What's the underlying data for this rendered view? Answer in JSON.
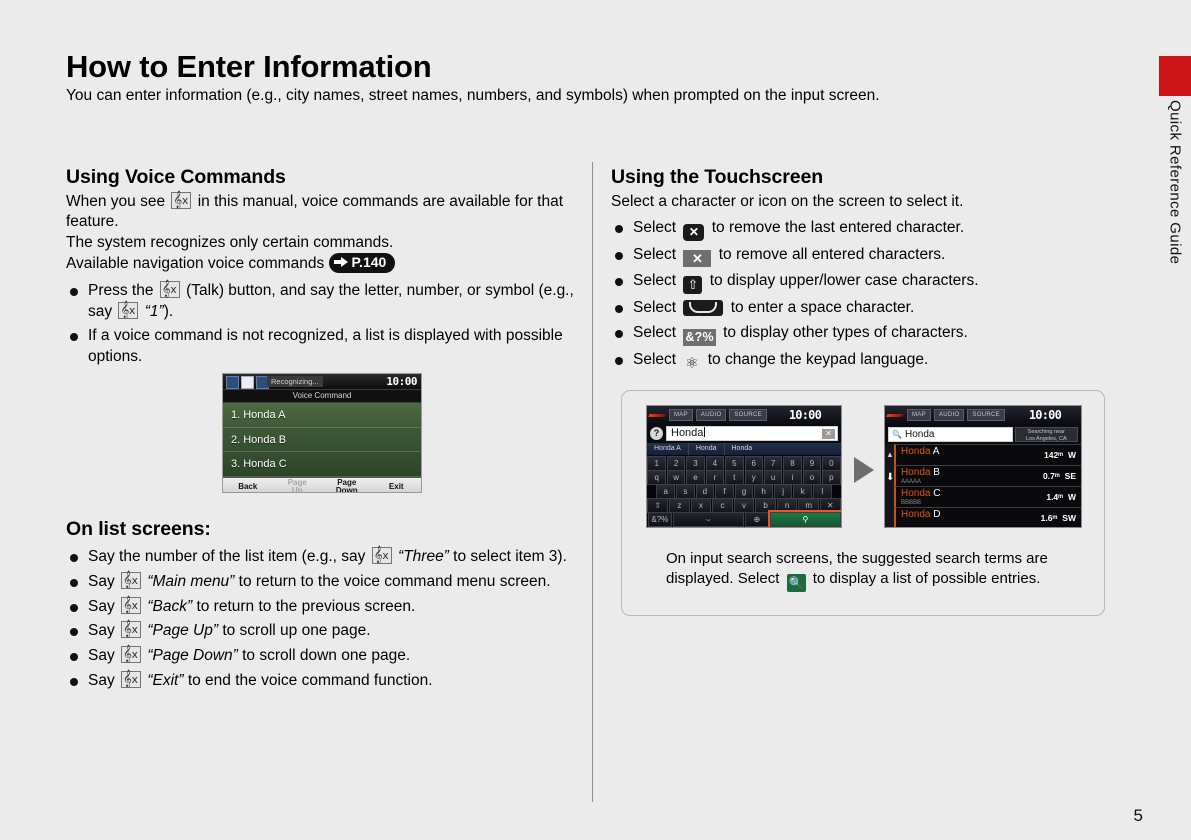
{
  "header": {
    "title": "How to Enter Information",
    "lede": "You can enter information (e.g., city names, street names, numbers, and symbols) when prompted on the input screen."
  },
  "side_tab": {
    "label": "Quick Reference Guide",
    "color": "#cc1417"
  },
  "page_number": "5",
  "left_column": {
    "section_title": "Using Voice Commands",
    "intro_a": "When you see",
    "intro_b": "in this manual, voice commands are available for that feature.",
    "para2_line1": "The system recognizes only certain commands.",
    "para2_line2": "Available navigation voice commands",
    "page_ref": "P.140",
    "bullets": [
      {
        "pre": "Press the",
        "mid": "(Talk) button, and say the letter, number, or symbol (e.g., say",
        "quoted": "“1”",
        "post": ")."
      },
      {
        "text": "If a voice command is not recognized, a list is displayed with possible options."
      }
    ],
    "list_section_title": "On list screens:",
    "list_bullets": [
      {
        "pre": "Say the number of the list item (e.g., say",
        "quoted": "“Three”",
        "post": "to select item 3)."
      },
      {
        "pre": "Say",
        "quoted": "“Main menu”",
        "post": "to return to the voice command menu screen."
      },
      {
        "pre": "Say",
        "quoted": "“Back”",
        "post": "to return to the previous screen."
      },
      {
        "pre": "Say",
        "quoted": "“Page Up”",
        "post": "to scroll up one page."
      },
      {
        "pre": "Say",
        "quoted": "“Page Down”",
        "post": "to scroll down one page."
      },
      {
        "pre": "Say",
        "quoted": "“Exit”",
        "post": "to end the voice command function."
      }
    ]
  },
  "voice_command_screen": {
    "status": "Recognizing...",
    "clock": "10:00",
    "subtitle": "Voice Command",
    "items": [
      "1. Honda A",
      "2. Honda B",
      "3. Honda C"
    ],
    "buttons": [
      {
        "label": "Back",
        "label2": "",
        "dim": false
      },
      {
        "label": "Page",
        "label2": "Up",
        "dim": true
      },
      {
        "label": "Page",
        "label2": "Down",
        "dim": false
      },
      {
        "label": "Exit",
        "label2": "",
        "dim": false
      }
    ]
  },
  "right_column": {
    "section_title": "Using the Touchscreen",
    "intro": "Select a character or icon on the screen to select it.",
    "bullets": [
      {
        "pre": "Select",
        "icon": "backspace-icon",
        "post": "to remove the last entered character."
      },
      {
        "pre": "Select",
        "icon": "delete-all-icon",
        "post": "to remove all entered characters."
      },
      {
        "pre": "Select",
        "icon": "shift-icon",
        "post": "to display upper/lower case characters."
      },
      {
        "pre": "Select",
        "icon": "space-icon",
        "post": "to enter a space character."
      },
      {
        "pre": "Select",
        "icon": "symbols-icon",
        "label": "&?%",
        "post": "to display other types of characters."
      },
      {
        "pre": "Select",
        "icon": "globe-icon",
        "post": "to change the keypad language."
      }
    ],
    "caption_a": "On input search screens, the suggested search terms are displayed. Select",
    "caption_b": "to display a list of possible entries."
  },
  "nav_keyboard_screen": {
    "tabs": [
      "MAP",
      "AUDIO",
      "SOURCE"
    ],
    "clock": "10:00",
    "help_icon": "?",
    "input_value": "Honda",
    "clear_icon": "✕",
    "suggestions": [
      "Honda A",
      "Honda",
      "Honda"
    ],
    "rows": [
      [
        "1",
        "2",
        "3",
        "4",
        "5",
        "6",
        "7",
        "8",
        "9",
        "0"
      ],
      [
        "q",
        "w",
        "e",
        "r",
        "t",
        "y",
        "u",
        "i",
        "o",
        "p"
      ],
      [
        "a",
        "s",
        "d",
        "f",
        "g",
        "h",
        "j",
        "k",
        "l"
      ],
      [
        "z",
        "x",
        "c",
        "v",
        "b",
        "n",
        "m"
      ]
    ],
    "shift_key": "⇧",
    "backspace_key": "✕",
    "symbols_key": "&?%",
    "space_key": "⌣",
    "globe_key": "⊕",
    "search_key": "⚲"
  },
  "nav_results_screen": {
    "tabs": [
      "MAP",
      "AUDIO",
      "SOURCE"
    ],
    "clock": "10:00",
    "search_value": "Honda",
    "near_line1": "Searching near",
    "near_line2": "Los Angeles, CA",
    "results": [
      {
        "brand": "Honda",
        "suffix": "A",
        "sub": "",
        "distance": "142ᵐ",
        "dir": "W"
      },
      {
        "brand": "Honda",
        "suffix": "B",
        "sub": "AAAAA",
        "distance": "0.7ᵐ",
        "dir": "SE"
      },
      {
        "brand": "Honda",
        "suffix": "C",
        "sub": "BBBBB",
        "distance": "1.4ᵐ",
        "dir": "W"
      },
      {
        "brand": "Honda",
        "suffix": "D",
        "sub": "",
        "distance": "1.6ᵐ",
        "dir": "SW"
      }
    ]
  }
}
